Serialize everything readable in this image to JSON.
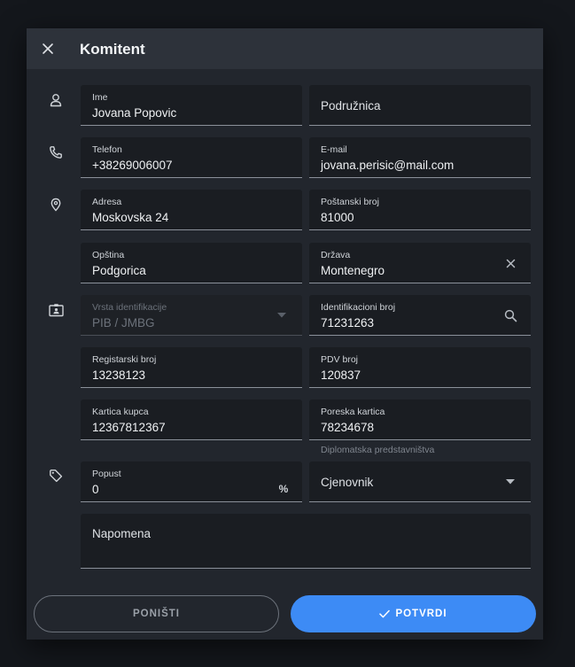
{
  "dialog": {
    "title": "Komitent",
    "accent_color": "#3d8bf5"
  },
  "fields": {
    "ime": {
      "label": "Ime",
      "value": "Jovana Popovic"
    },
    "podruznica": {
      "placeholder": "Podružnica"
    },
    "telefon": {
      "label": "Telefon",
      "value": "+38269006007"
    },
    "email": {
      "label": "E-mail",
      "value": "jovana.perisic@mail.com"
    },
    "adresa": {
      "label": "Adresa",
      "value": "Moskovska 24"
    },
    "postanski_broj": {
      "label": "Poštanski broj",
      "value": "81000"
    },
    "opstina": {
      "label": "Opština",
      "value": "Podgorica"
    },
    "drzava": {
      "label": "Država",
      "value": "Montenegro"
    },
    "vrsta_identifikacije": {
      "label": "Vrsta identifikacije",
      "value": "PIB / JMBG",
      "disabled": true
    },
    "identifikacioni_broj": {
      "label": "Identifikacioni broj",
      "value": "71231263"
    },
    "registarski_broj": {
      "label": "Registarski broj",
      "value": "13238123"
    },
    "pdv_broj": {
      "label": "PDV broj",
      "value": "120837"
    },
    "kartica_kupca": {
      "label": "Kartica kupca",
      "value": "12367812367"
    },
    "poreska_kartica": {
      "label": "Poreska kartica",
      "value": "78234678",
      "helper": "Diplomatska predstavništva"
    },
    "popust": {
      "label": "Popust",
      "value": "0",
      "suffix": "%"
    },
    "cjenovnik": {
      "placeholder": "Cjenovnik"
    },
    "napomena": {
      "placeholder": "Napomena"
    }
  },
  "icons": {
    "close": "close-icon",
    "person": "person-icon",
    "phone": "phone-icon",
    "location": "location-pin-icon",
    "id_card": "id-card-icon",
    "tag": "tag-icon",
    "clear": "clear-icon",
    "search": "search-icon",
    "dropdown": "dropdown-arrow-icon",
    "percent": "percent-icon",
    "check": "check-icon"
  },
  "buttons": {
    "cancel": "PONIŠTI",
    "confirm": "POTVRDI"
  }
}
